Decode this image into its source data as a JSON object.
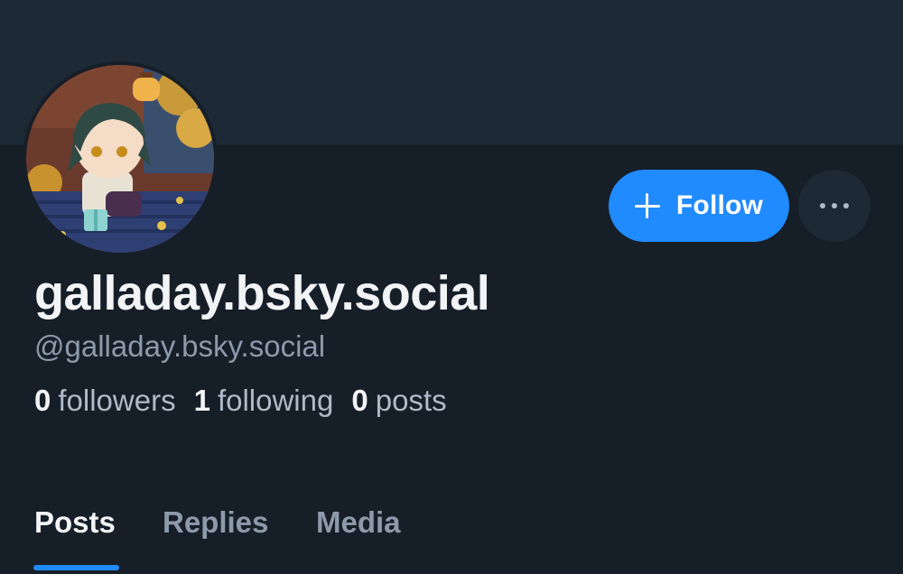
{
  "profile": {
    "display_name": "galladay.bsky.social",
    "handle": "@galladay.bsky.social",
    "avatar": "avatar-illustration"
  },
  "actions": {
    "follow_label": "Follow",
    "follow_icon": "plus-icon",
    "more_icon": "ellipsis-icon"
  },
  "stats": [
    {
      "count": "0",
      "label": "followers"
    },
    {
      "count": "1",
      "label": "following"
    },
    {
      "count": "0",
      "label": "posts"
    }
  ],
  "tabs": [
    {
      "label": "Posts",
      "active": true
    },
    {
      "label": "Replies",
      "active": false
    },
    {
      "label": "Media",
      "active": false
    }
  ],
  "colors": {
    "background": "#161e27",
    "banner": "#1e2936",
    "accent": "#208bfe",
    "text_primary": "#f1f3f5",
    "text_secondary": "#8d9aab"
  }
}
